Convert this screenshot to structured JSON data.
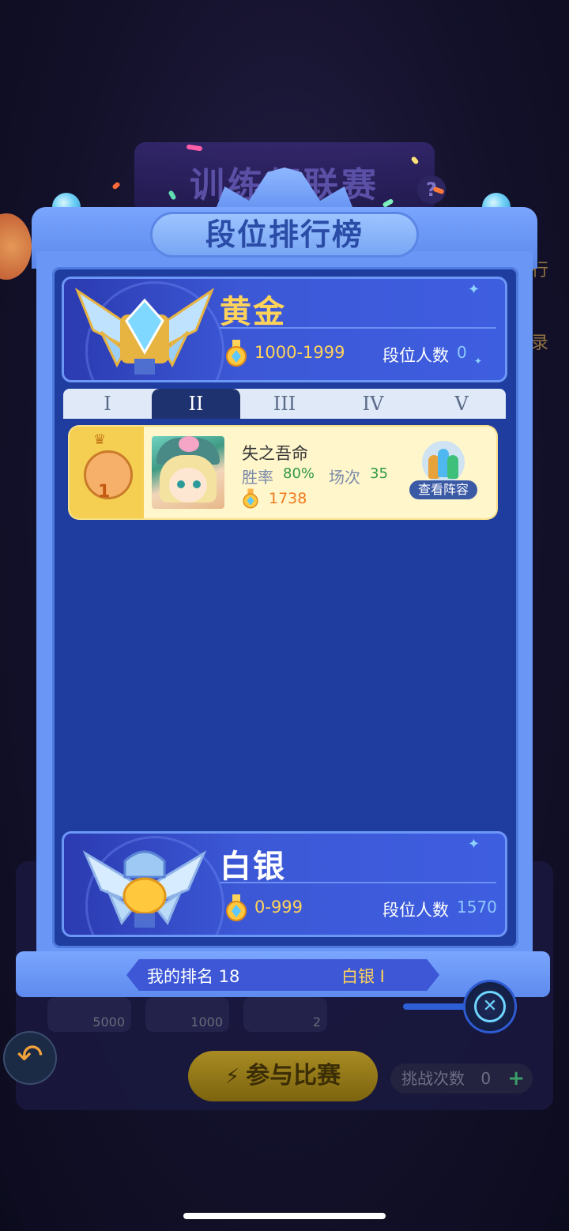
{
  "background": {
    "event_title": "训练师联赛",
    "side_labels": [
      "排行",
      "记录"
    ],
    "chips": [
      "5000",
      "1000",
      "2"
    ],
    "join_button": "参与比赛",
    "challenge_label": "挑战次数",
    "challenge_count": "0"
  },
  "panel": {
    "title": "段位排行榜",
    "tabs": [
      "I",
      "II",
      "III",
      "IV",
      "V"
    ],
    "active_tab": "II",
    "current_tier": {
      "name": "黄金",
      "range": "1000-1999",
      "count_label": "段位人数",
      "count": "0"
    },
    "next_tier": {
      "name": "白银",
      "range": "0-999",
      "count_label": "段位人数",
      "count": "1570"
    },
    "rankings": [
      {
        "rank": "1",
        "name": "失之吾命",
        "win_label": "胜率",
        "win_rate": "80%",
        "games_label": "场次",
        "games": "35",
        "score": "1738",
        "lineup_button": "查看阵容"
      }
    ],
    "my_rank": {
      "label": "我的排名 18",
      "tier": "白银 I"
    }
  },
  "colors": {
    "gold_text": "#ffd35a",
    "panel_blue": "#1f3d9e",
    "frame_blue": "#6a97f5",
    "win_green": "#2f9a44",
    "score_orange": "#f07a1e"
  },
  "icons": [
    "help-icon",
    "back-arrow-icon",
    "close-icon",
    "medal-icon",
    "crown-icon",
    "plus-icon",
    "lightning-icon"
  ]
}
